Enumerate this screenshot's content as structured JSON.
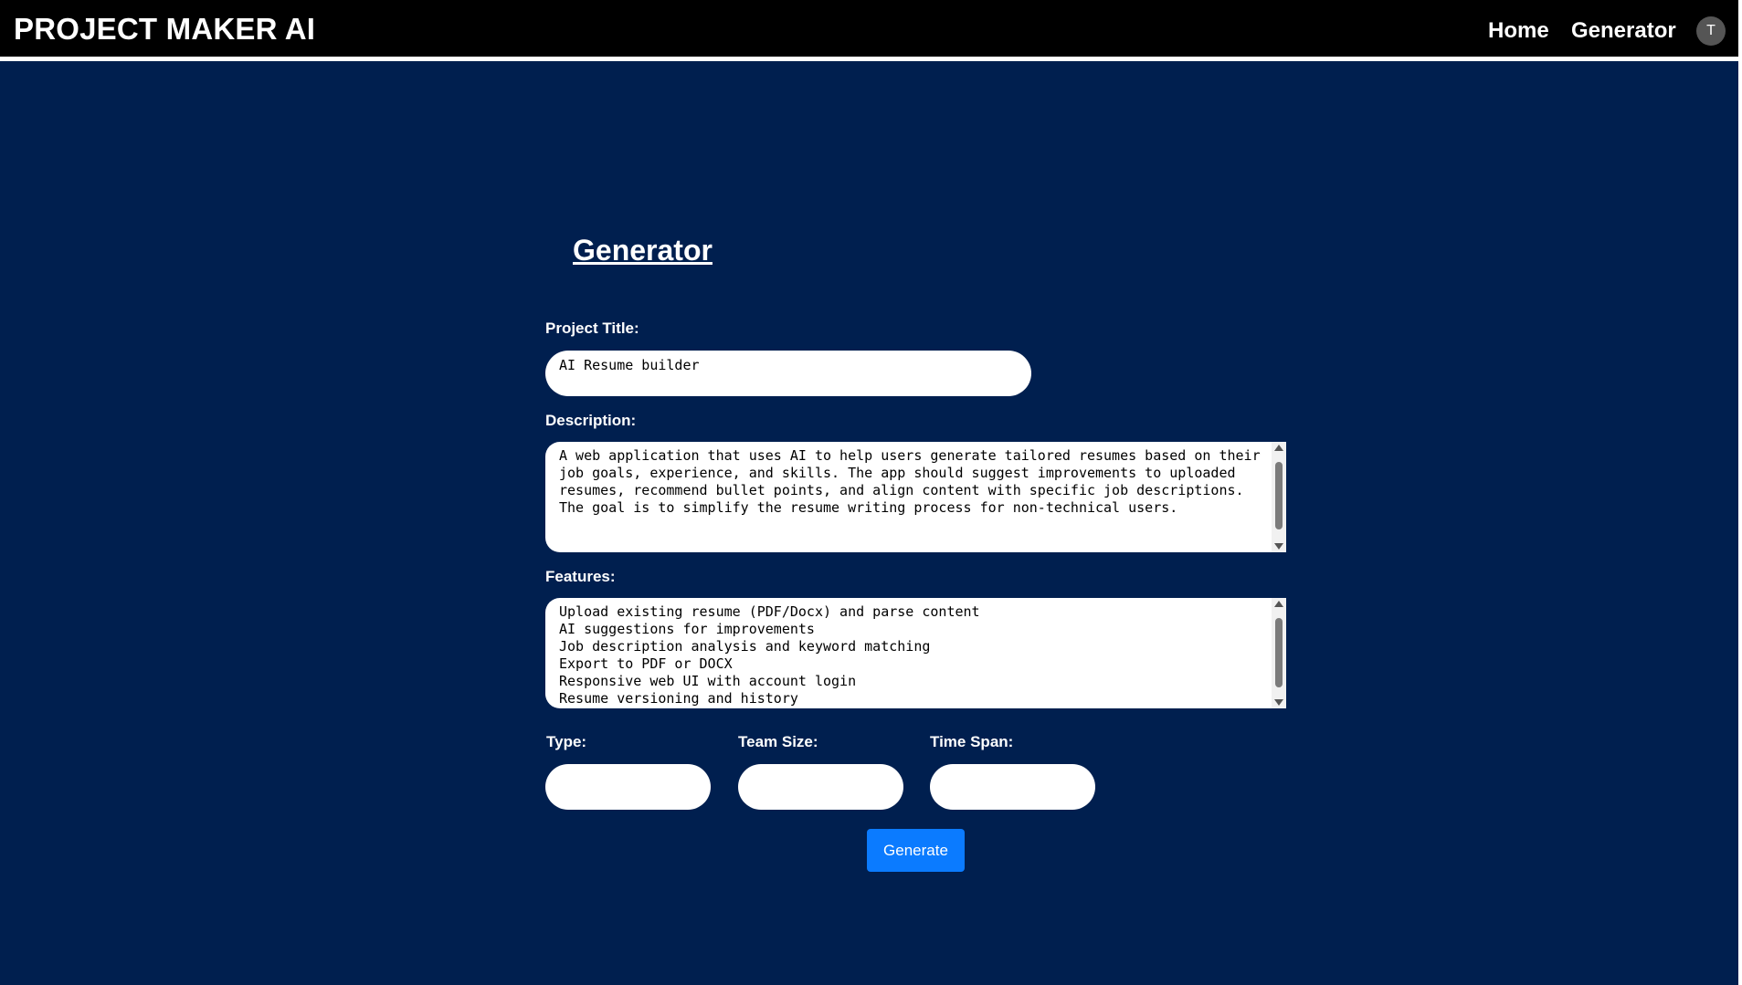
{
  "header": {
    "brand": "PROJECT MAKER AI",
    "nav": [
      {
        "label": "Home"
      },
      {
        "label": "Generator"
      }
    ],
    "avatar_initial": "T"
  },
  "form": {
    "heading": "Generator",
    "project_title": {
      "label": "Project Title:",
      "value": "AI Resume builder"
    },
    "description": {
      "label": "Description:",
      "value": "A web application that uses AI to help users generate tailored resumes based on their job goals, experience, and skills. The app should suggest improvements to uploaded resumes, recommend bullet points, and align content with specific job descriptions. The goal is to simplify the resume writing process for non-technical users."
    },
    "features": {
      "label": "Features:",
      "value": "Upload existing resume (PDF/Docx) and parse content\nAI suggestions for improvements\nJob description analysis and keyword matching\nExport to PDF or DOCX\nResponsive web UI with account login\nResume versioning and history"
    },
    "type": {
      "label": "Type:",
      "value": ""
    },
    "team_size": {
      "label": "Team Size:",
      "value": ""
    },
    "time_span": {
      "label": "Time Span:",
      "value": ""
    },
    "generate_label": "Generate"
  },
  "colors": {
    "background": "#001f4f",
    "topbar": "#000000",
    "button": "#0b7bff"
  }
}
